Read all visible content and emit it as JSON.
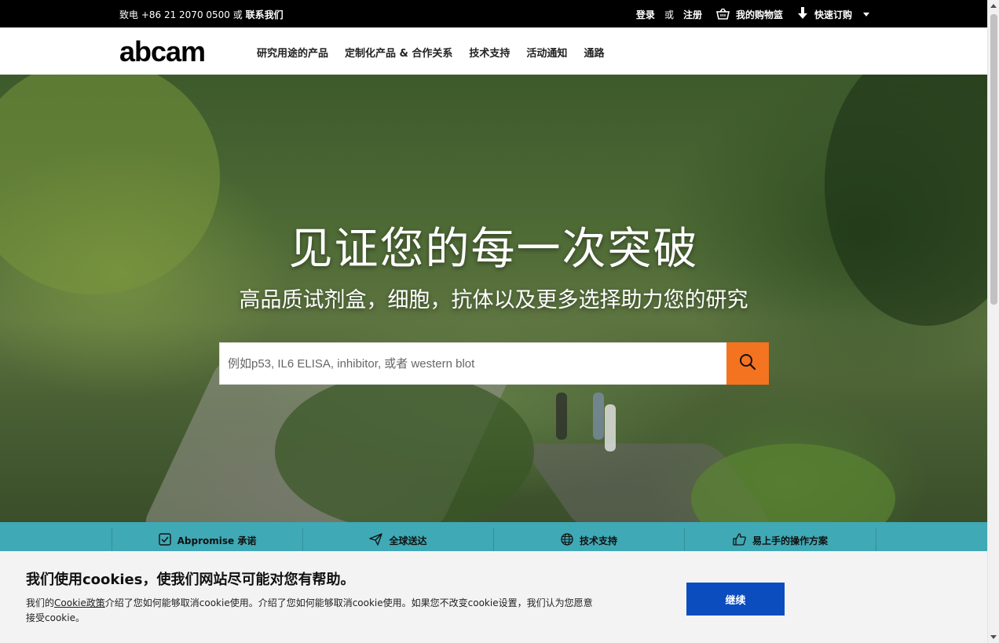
{
  "topbar": {
    "contact_prefix": "致电 +86 21 2070 0500 或",
    "contact_link": "联系我们",
    "login": "登录",
    "or": "或",
    "register": "注册",
    "cart": "我的购物篮",
    "quick_order": "快速订购"
  },
  "header": {
    "logo": "abcam",
    "nav": [
      "研究用途的产品",
      "定制化产品 & 合作关系",
      "技术支持",
      "活动通知",
      "通路"
    ]
  },
  "hero": {
    "title": "见证您的每一次突破",
    "subtitle": "高品质试剂盒，细胞，抗体以及更多选择助力您的研究",
    "search_placeholder": "例如p53, IL6 ELISA, inhibitor, 或者 western blot"
  },
  "features": [
    {
      "label": "Abpromise 承诺",
      "icon": "checkbox-icon"
    },
    {
      "label": "全球送达",
      "icon": "plane-icon"
    },
    {
      "label": "技术支持",
      "icon": "globe-icon"
    },
    {
      "label": "易上手的操作方案",
      "icon": "thumbs-up-icon"
    }
  ],
  "cookie": {
    "title": "我们使用cookies，使我们网站尽可能对您有帮助。",
    "text_prefix": "我们的",
    "policy_link": "Cookie政策",
    "text_suffix": "介绍了您如何能够取消cookie使用。介绍了您如何能够取消cookie使用。如果您不改变cookie设置，我们认为您愿意接受cookie。",
    "accept": "继续"
  },
  "colors": {
    "accent_orange": "#f47321",
    "strip_teal": "#3fa9b5",
    "cookie_button_blue": "#0b4dbf"
  }
}
